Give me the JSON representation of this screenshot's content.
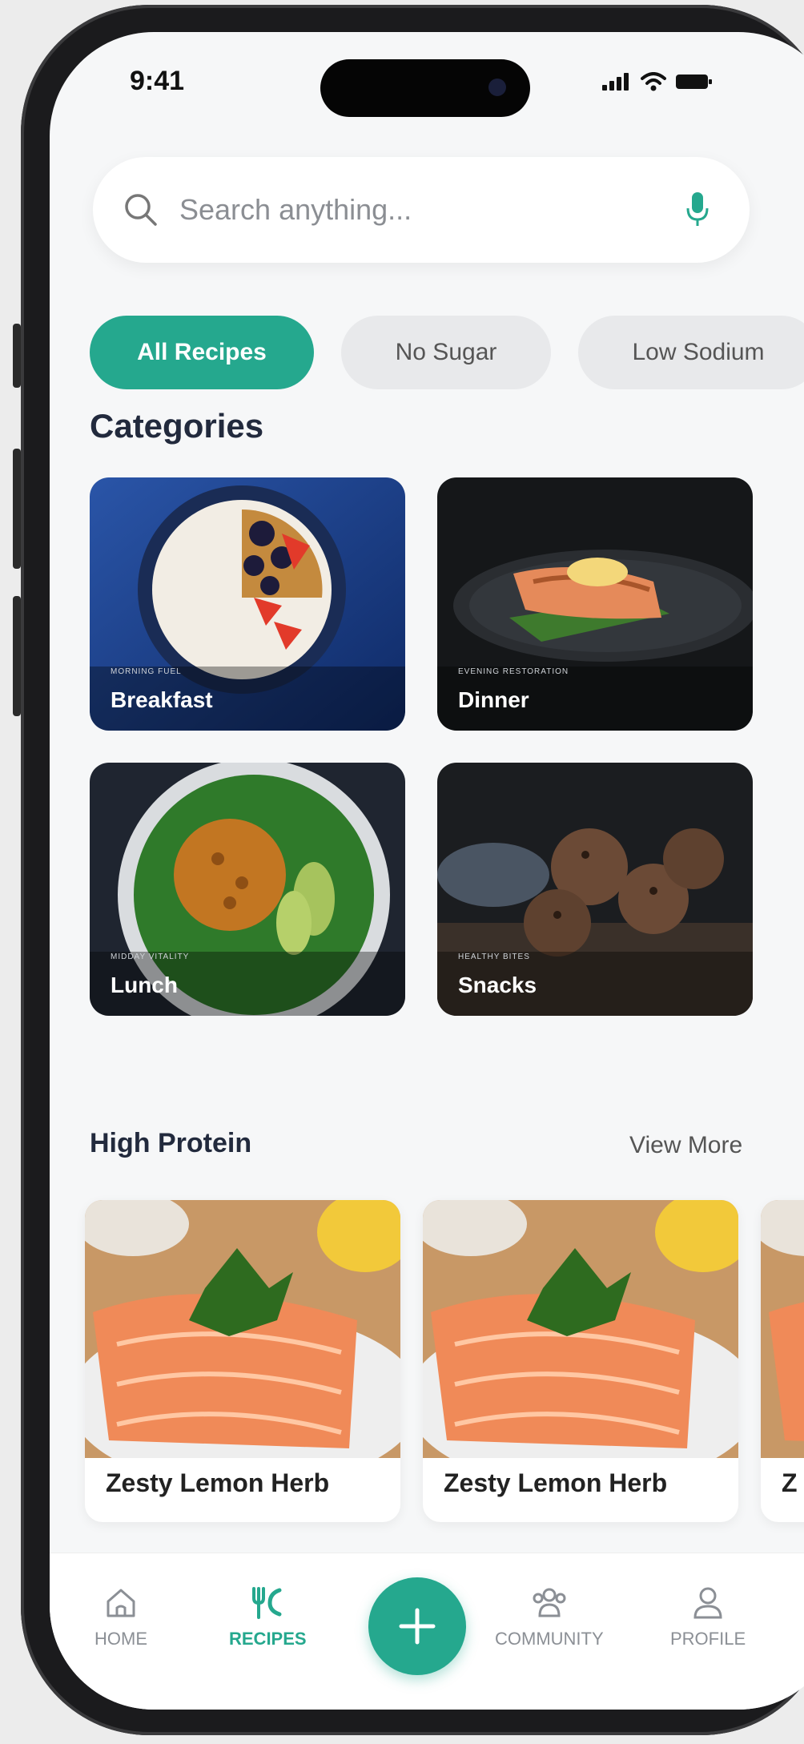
{
  "status_bar": {
    "time": "9:41"
  },
  "search": {
    "placeholder": "Search anything..."
  },
  "filters": [
    {
      "label": "All Recipes",
      "active": true
    },
    {
      "label": "No Sugar",
      "active": false
    },
    {
      "label": "Low Sodium",
      "active": false
    }
  ],
  "categories_section": {
    "title": "Categories"
  },
  "categories": [
    {
      "label": "Breakfast",
      "tag": "MORNING FUEL"
    },
    {
      "label": "Dinner",
      "tag": "EVENING RESTORATION"
    },
    {
      "label": "Lunch",
      "tag": "MIDDAY VITALITY"
    },
    {
      "label": "Snacks",
      "tag": "HEALTHY BITES"
    }
  ],
  "high_protein": {
    "title": "High Protein",
    "view_more": "View More",
    "recipes": [
      {
        "title": "Zesty Lemon Herb"
      },
      {
        "title": "Zesty Lemon Herb"
      },
      {
        "title": "Z"
      }
    ]
  },
  "tabbar": {
    "home": "HOME",
    "recipes": "RECIPES",
    "community": "COMMUNITY",
    "profile": "PROFILE"
  },
  "colors": {
    "accent": "#25a88e",
    "background": "#f6f7f8",
    "title_text": "#222a3d"
  }
}
